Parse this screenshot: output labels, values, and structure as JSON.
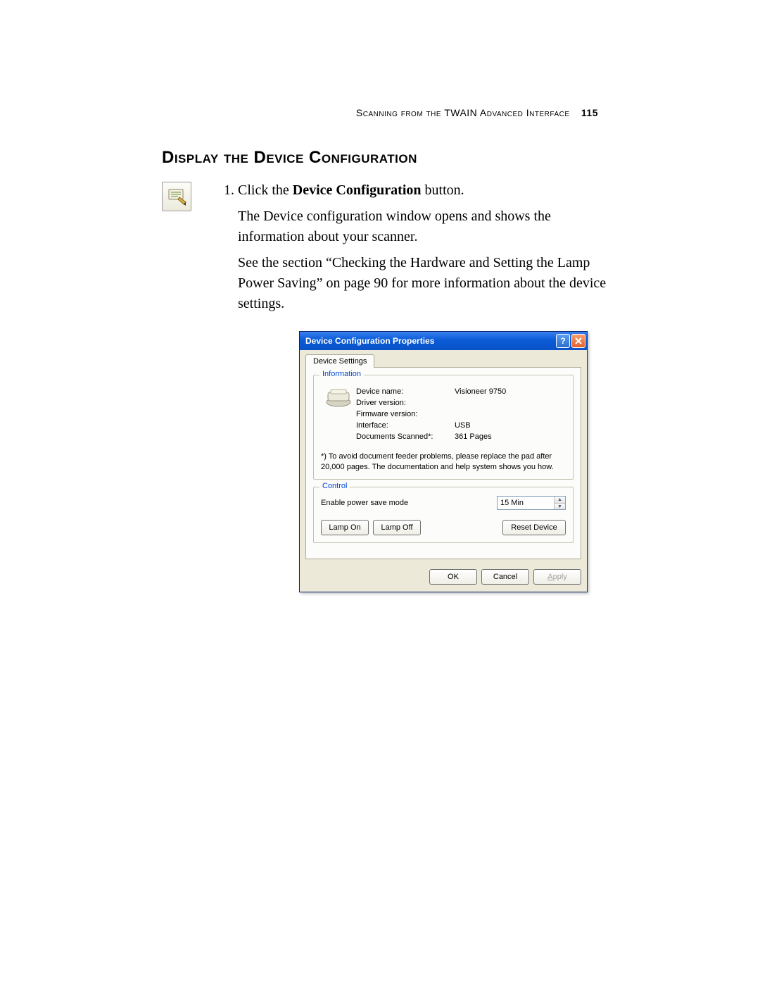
{
  "header": {
    "running_head": "Scanning from the TWAIN Advanced Interface",
    "page_number": "115"
  },
  "section": {
    "heading": "Display the Device Configuration",
    "step1_prefix": "Click the ",
    "step1_bold": "Device Configuration",
    "step1_suffix": " button.",
    "para1": "The Device configuration window opens and shows the information about your scanner.",
    "para2": "See the section “Checking the Hardware and Setting the Lamp Power Saving” on page 90 for more information about the device settings."
  },
  "dialog": {
    "title": "Device Configuration Properties",
    "tab_label": "Device Settings",
    "groups": {
      "information": {
        "legend": "Information",
        "rows": [
          {
            "label": "Device name:",
            "value": "Visioneer 9750"
          },
          {
            "label": "Driver version:",
            "value": ""
          },
          {
            "label": "Firmware version:",
            "value": ""
          },
          {
            "label": "Interface:",
            "value": "USB"
          },
          {
            "label": "Documents Scanned*:",
            "value": "361 Pages"
          }
        ],
        "footnote": "*) To avoid document feeder problems, please replace the pad after 20,000 pages. The documentation and help system shows you how."
      },
      "control": {
        "legend": "Control",
        "power_save_label": "Enable power save mode",
        "power_save_value": "15 Min",
        "lamp_on": "Lamp On",
        "lamp_off": "Lamp Off",
        "reset": "Reset Device"
      }
    },
    "footer": {
      "ok": "OK",
      "cancel": "Cancel",
      "apply": "Apply"
    }
  }
}
